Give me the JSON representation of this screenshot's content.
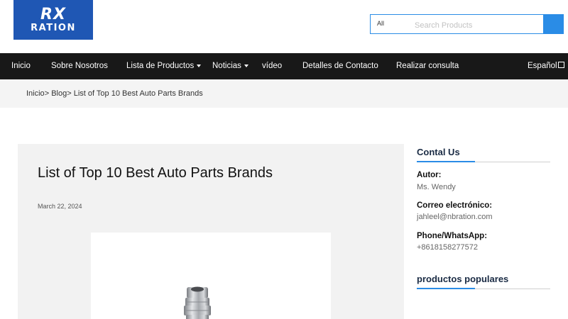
{
  "brand": {
    "logo_mark": "RX",
    "logo_text": "RATION",
    "color": "#1f57b4"
  },
  "search": {
    "category": "All",
    "placeholder": "Search Products",
    "button_icon": "search-icon",
    "accent": "#2a8ce6"
  },
  "nav": {
    "items": [
      {
        "label": "Inicio",
        "dropdown": false
      },
      {
        "label": "Sobre Nosotros",
        "dropdown": false
      },
      {
        "label": "Lista de Productos",
        "dropdown": true
      },
      {
        "label": "Noticias",
        "dropdown": true
      },
      {
        "label": "vídeo",
        "dropdown": false
      },
      {
        "label": "Detalles de Contacto",
        "dropdown": false
      },
      {
        "label": "Realizar consulta",
        "dropdown": false
      }
    ],
    "language": "Español"
  },
  "breadcrumb": {
    "home": "Inicio",
    "blog": "Blog",
    "current": "List of Top 10 Best Auto Parts Brands",
    "separator": ">"
  },
  "article": {
    "title": "List of Top 10 Best Auto Parts Brands",
    "date": "March 22, 2024"
  },
  "sidebar": {
    "contact_heading": "Contal Us",
    "author_label": "Autor:",
    "author_value": "Ms. Wendy",
    "email_label": "Correo electrónico:",
    "email_value": "jahleel@nbration.com",
    "phone_label": "Phone/WhatsApp:",
    "phone_value": "+8618158277572",
    "popular_heading": "productos populares"
  }
}
